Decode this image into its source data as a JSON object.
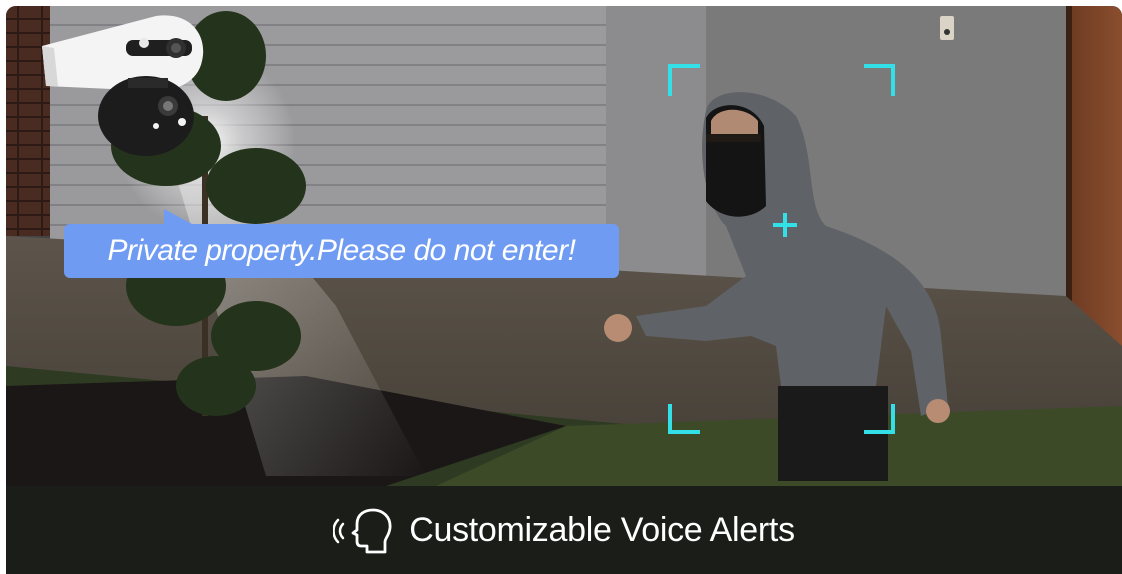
{
  "alert": {
    "message": "Private property.Please do not enter!"
  },
  "caption": {
    "icon": "voice-alert-icon",
    "label": "Customizable Voice Alerts"
  },
  "colors": {
    "bubble": "#6f9cf2",
    "detection_frame": "#33e0e8",
    "caption_bar": "#161616"
  }
}
